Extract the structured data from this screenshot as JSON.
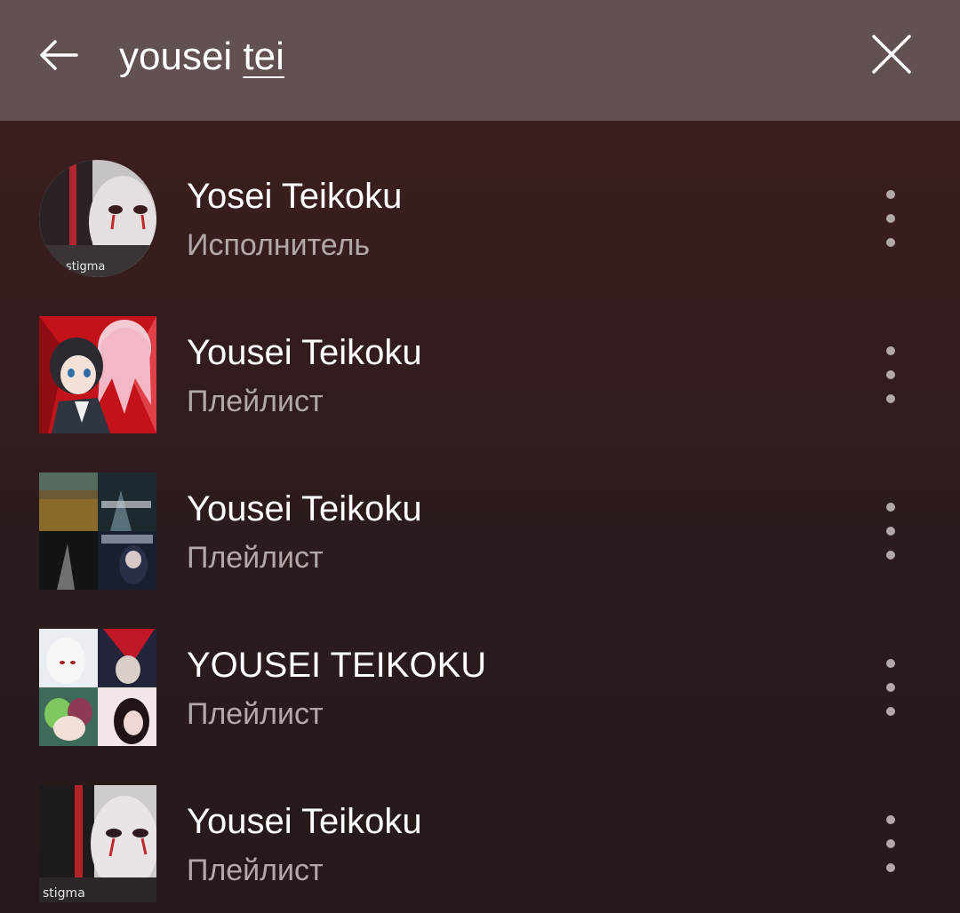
{
  "search": {
    "query_committed": "yousei ",
    "query_composing": "tei"
  },
  "icons": {
    "back": "arrow-left-icon",
    "clear": "close-icon",
    "more": "more-vertical-icon"
  },
  "colors": {
    "header_bg": "#635051",
    "background": "#3a1f20",
    "title": "#ffffff",
    "subtitle": "#b3a8a8"
  },
  "results": [
    {
      "title": "Yosei Teikoku",
      "subtitle": "Исполнитель",
      "thumb_shape": "round"
    },
    {
      "title": "Yousei Teikoku",
      "subtitle": "Плейлист",
      "thumb_shape": "square"
    },
    {
      "title": "Yousei Teikoku",
      "subtitle": "Плейлист",
      "thumb_shape": "mosaic"
    },
    {
      "title": "YOUSEI TEIKOKU",
      "subtitle": "Плейлист",
      "thumb_shape": "mosaic"
    },
    {
      "title": "Yousei Teikoku",
      "subtitle": "Плейлист",
      "thumb_shape": "square"
    }
  ]
}
